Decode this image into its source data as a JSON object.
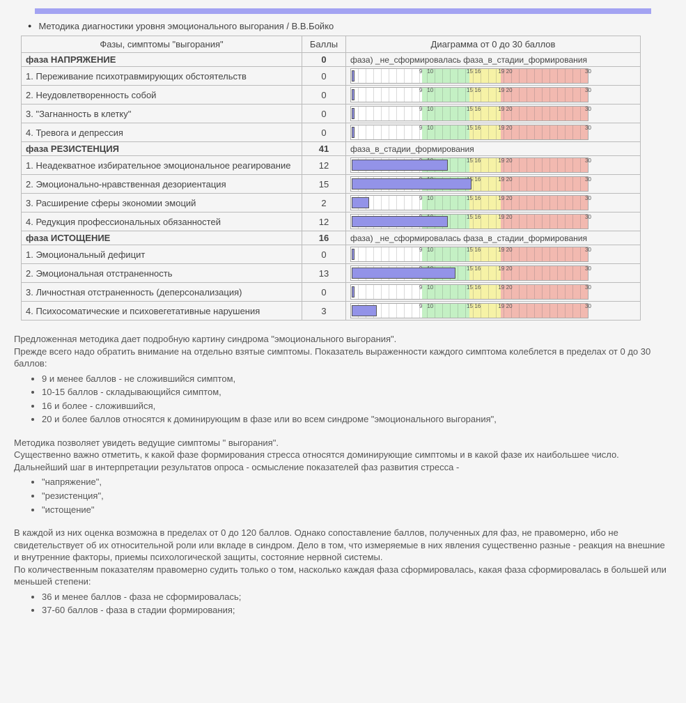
{
  "chart_data": {
    "type": "bar",
    "title": "Диаграмма от 0 до 30 баллов",
    "xlabel": "",
    "ylabel": "Баллы",
    "ylim": [
      0,
      30
    ],
    "zones": [
      {
        "from": 0,
        "to": 9,
        "color": "#ffffff",
        "label": "не_сложившийся_симптом"
      },
      {
        "from": 9,
        "to": 15,
        "color": "#c4f0c4",
        "label": "складывающийся_симптом"
      },
      {
        "from": 15,
        "to": 19,
        "color": "#f6f2a6",
        "label": "сложившийся"
      },
      {
        "from": 19,
        "to": 30,
        "color": "#f2b9b0",
        "label": "доминирующий"
      }
    ],
    "ticks": [
      9,
      10,
      15,
      16,
      19,
      20,
      30
    ],
    "series": [
      {
        "group": "НАПРЯЖЕНИЕ",
        "name": "Переживание психотравмирующих обстоятельств",
        "value": 0
      },
      {
        "group": "НАПРЯЖЕНИЕ",
        "name": "Неудовлетворенность собой",
        "value": 0
      },
      {
        "group": "НАПРЯЖЕНИЕ",
        "name": "\"Загнанность в клетку\"",
        "value": 0
      },
      {
        "group": "НАПРЯЖЕНИЕ",
        "name": "Тревога и депрессия",
        "value": 0
      },
      {
        "group": "РЕЗИСТЕНЦИЯ",
        "name": "Неадекватное избирательное эмоциональное реагирование",
        "value": 12
      },
      {
        "group": "РЕЗИСТЕНЦИЯ",
        "name": "Эмоционально-нравственная дезориентация",
        "value": 15
      },
      {
        "group": "РЕЗИСТЕНЦИЯ",
        "name": "Расширение сферы экономии эмоций",
        "value": 2
      },
      {
        "group": "РЕЗИСТЕНЦИЯ",
        "name": "Редукция профессиональных обязанностей",
        "value": 12
      },
      {
        "group": "ИСТОЩЕНИЕ",
        "name": "Эмоциональный дефицит",
        "value": 0
      },
      {
        "group": "ИСТОЩЕНИЕ",
        "name": "Эмоциональная отстраненность",
        "value": 13
      },
      {
        "group": "ИСТОЩЕНИЕ",
        "name": "Личностная отстраненность (деперсонализация)",
        "value": 0
      },
      {
        "group": "ИСТОЩЕНИЕ",
        "name": "Психосоматические и психовегетативные нарушения",
        "value": 3
      }
    ],
    "phase_scale": {
      "max": 120,
      "thresholds": [
        36,
        60
      ]
    }
  },
  "title": "Методика диагностики уровня эмоционального выгорания / В.В.Бойко",
  "columns": {
    "name": "Фазы, симптомы \"выгорания\"",
    "score": "Баллы",
    "diagram": "Диаграмма от 0 до 30 баллов"
  },
  "phase_label_not_formed": "фаза) _не_сформировалась",
  "phase_label_forming": "фаза_в_стадии_формирования",
  "phases": [
    {
      "title": "фаза НАПРЯЖЕНИЕ",
      "total": 0,
      "diag": "фаза) _не_сформировалась  фаза_в_стадии_формирования",
      "rows": [
        {
          "n": "1.",
          "name": "Переживание психотравмирующих обстоятельств",
          "score": 0
        },
        {
          "n": "2.",
          "name": "Неудовлетворенность собой",
          "score": 0
        },
        {
          "n": "3.",
          "name": "\"Загнанность в клетку\"",
          "score": 0
        },
        {
          "n": "4.",
          "name": "Тревога и депрессия",
          "score": 0
        }
      ]
    },
    {
      "title": "фаза РЕЗИСТЕНЦИЯ",
      "total": 41,
      "diag": "фаза_в_стадии_формирования",
      "rows": [
        {
          "n": "1.",
          "name": "Неадекватное избирательное эмоциональное реагирование",
          "score": 12
        },
        {
          "n": "2.",
          "name": "Эмоционально-нравственная дезориентация",
          "score": 15
        },
        {
          "n": "3.",
          "name": "Расширение сферы экономии эмоций",
          "score": 2
        },
        {
          "n": "4.",
          "name": "Редукция профессиональных обязанностей",
          "score": 12
        }
      ]
    },
    {
      "title": "фаза ИСТОЩЕНИЕ",
      "total": 16,
      "diag": "фаза) _не_сформировалась  фаза_в_стадии_формирования",
      "rows": [
        {
          "n": "1.",
          "name": "Эмоциональный дефицит",
          "score": 0
        },
        {
          "n": "2.",
          "name": "Эмоциональная отстраненность",
          "score": 13
        },
        {
          "n": "3.",
          "name": "Личностная отстраненность (деперсонализация)",
          "score": 0
        },
        {
          "n": "4.",
          "name": "Психосоматические и психовегетативные нарушения",
          "score": 3
        }
      ]
    }
  ],
  "desc": {
    "p1": "Предложенная методика дает подробную картину синдрома \"эмоционального выгорания\".",
    "p2": "Прежде всего надо обратить внимание на отдельно взятые симптомы. Показатель выраженности каждого симптома колеблется в пределах от 0 до 30 баллов:",
    "list1": [
      "9 и менее баллов - не сложившийся симптом,",
      "10-15 баллов - складывающийся симптом,",
      "16 и более - сложившийся,",
      "20 и более баллов относятся к доминирующим в фазе или во всем синдроме \"эмоционального выгорания\","
    ],
    "p3": "Методика позволяет увидеть ведущие симптомы \" выгорания\".",
    "p4": "Существенно важно отметить, к какой фазе формирования стресса относятся доминирующие симптомы и в какой фазе их наибольшее число.",
    "p5": "Дальнейший шаг в интерпретации результатов опроса - осмысление показателей фаз развития стресса -",
    "list2": [
      "\"напряжение\",",
      "\"резистенция\",",
      "\"истощение\""
    ],
    "p6": "В каждой из них оценка возможна в пределах от 0 до 120 баллов. Однако сопоставление баллов, полученных для фаз, не правомерно, ибо не свидетельствует об их относительной роли или вкладе в синдром. Дело в том, что измеряемые в них явления существенно разные - реакция на внешние и внутренние факторы, приемы психологической защиты, состояние нервной системы.",
    "p7": "По количественным показателям правомерно судить только о том, насколько каждая фаза сформировалась, какая фаза сформировалась в большей или меньшей степени:",
    "list3": [
      "36 и менее баллов - фаза не сформировалась;",
      "37-60 баллов - фаза в стадии формирования;"
    ]
  }
}
